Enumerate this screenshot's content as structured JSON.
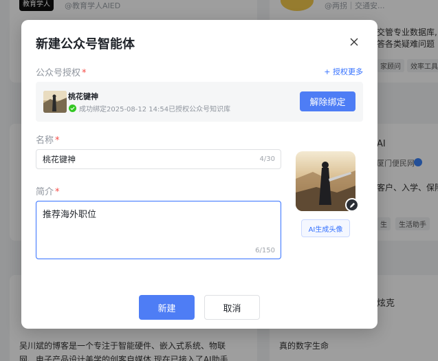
{
  "background": {
    "card1": {
      "logo_text": "教育学人",
      "handle": "@教育学人AIED"
    },
    "card2": {
      "handle": "@两拐｜交通安...",
      "desc_line1": "交管专业数据库,",
      "desc_line2": "答各类疑难问题",
      "tags": [
        "家顾问",
        "效率工具"
      ]
    },
    "card4": {
      "name": "AI",
      "org": "厦门便民网",
      "desc": "客户、入学、保险",
      "tags": [
        "生",
        "生活助手"
      ]
    },
    "card5": {
      "desc_line1": "吴川斌的博客是一个专注于智能硬件、嵌入式系统、物联",
      "desc_line2": "网、电子产品设计美学的创客自媒体,现在已接入了AI助手..."
    },
    "card6": {
      "name": "炫克",
      "desc": "真的数字生命"
    }
  },
  "modal": {
    "title": "新建公众号智能体",
    "auth_label": "公众号授权",
    "auth_more": "+ 授权更多",
    "account": {
      "name": "桃花键神",
      "status": "成功绑定2025-08-12 14:54已授权公众号知识库"
    },
    "unbind_label": "解除绑定",
    "name_label": "名称",
    "name_value": "桃花键神",
    "name_count": "4/30",
    "intro_label": "简介",
    "intro_value": "推荐海外职位",
    "intro_count": "6/150",
    "ai_generate_label": "AI生成头像",
    "ok_label": "新建",
    "cancel_label": "取消",
    "required_mark": "*"
  },
  "colors": {
    "primary": "#4e7df5",
    "link": "#3370ff",
    "required": "#f54a45",
    "success": "#34c724"
  }
}
